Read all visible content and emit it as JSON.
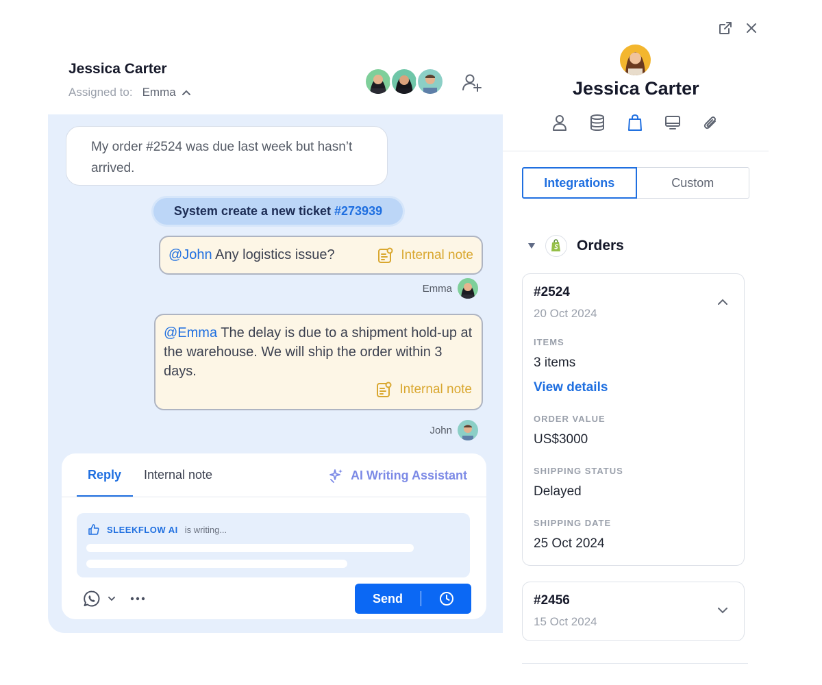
{
  "chat": {
    "title": "Jessica Carter",
    "assigned_label": "Assigned to:",
    "assigned_to": "Emma",
    "messages": {
      "customer": "My order #2524 was due last week but hasn’t arrived.",
      "system_prefix": "System create a new ticket",
      "system_ticket": "#273939",
      "note1_mention": "@John",
      "note1_text": " Any logistics issue?",
      "note1_sender": "Emma",
      "note2_mention": "@Emma",
      "note2_text": " The delay is due to a shipment hold-up at the warehouse. We will ship the order within 3 days.",
      "note2_sender": "John",
      "internal_note_label": "Internal note"
    },
    "composer": {
      "tabs": [
        "Reply",
        "Internal note"
      ],
      "ai_assistant": "AI Writing Assistant",
      "ai_brand": "SLEEKFLOW AI",
      "ai_status": "is writing...",
      "send_label": "Send"
    }
  },
  "profile": {
    "name": "Jessica Carter",
    "segments": [
      "Integrations",
      "Custom"
    ],
    "section_title": "Orders",
    "orders": [
      {
        "id": "#2524",
        "date": "20 Oct 2024",
        "items_label": "ITEMS",
        "items_value": "3 items",
        "details_link": "View details",
        "value_label": "ORDER VALUE",
        "value": "US$3000",
        "status_label": "SHIPPING STATUS",
        "status": "Delayed",
        "ship_date_label": "SHIPPING DATE",
        "ship_date": "25 Oct 2024"
      },
      {
        "id": "#2456",
        "date": "15 Oct 2024"
      }
    ]
  },
  "colors": {
    "accent": "#1f6fe0",
    "chat_bg": "#e6effc",
    "note_bg": "#fdf6e6",
    "note_label": "#d9a72f",
    "send_button": "#0b68f4"
  },
  "icons": [
    "external-link-icon",
    "close-icon",
    "add-user-icon",
    "chevron-up-icon",
    "person-icon",
    "database-icon",
    "bag-icon",
    "monitor-icon",
    "paperclip-icon",
    "note-icon",
    "sparkle-icon",
    "thumbs-up-icon",
    "whatsapp-icon",
    "more-icon",
    "clock-icon",
    "shopify-icon",
    "chevron-down-icon"
  ]
}
